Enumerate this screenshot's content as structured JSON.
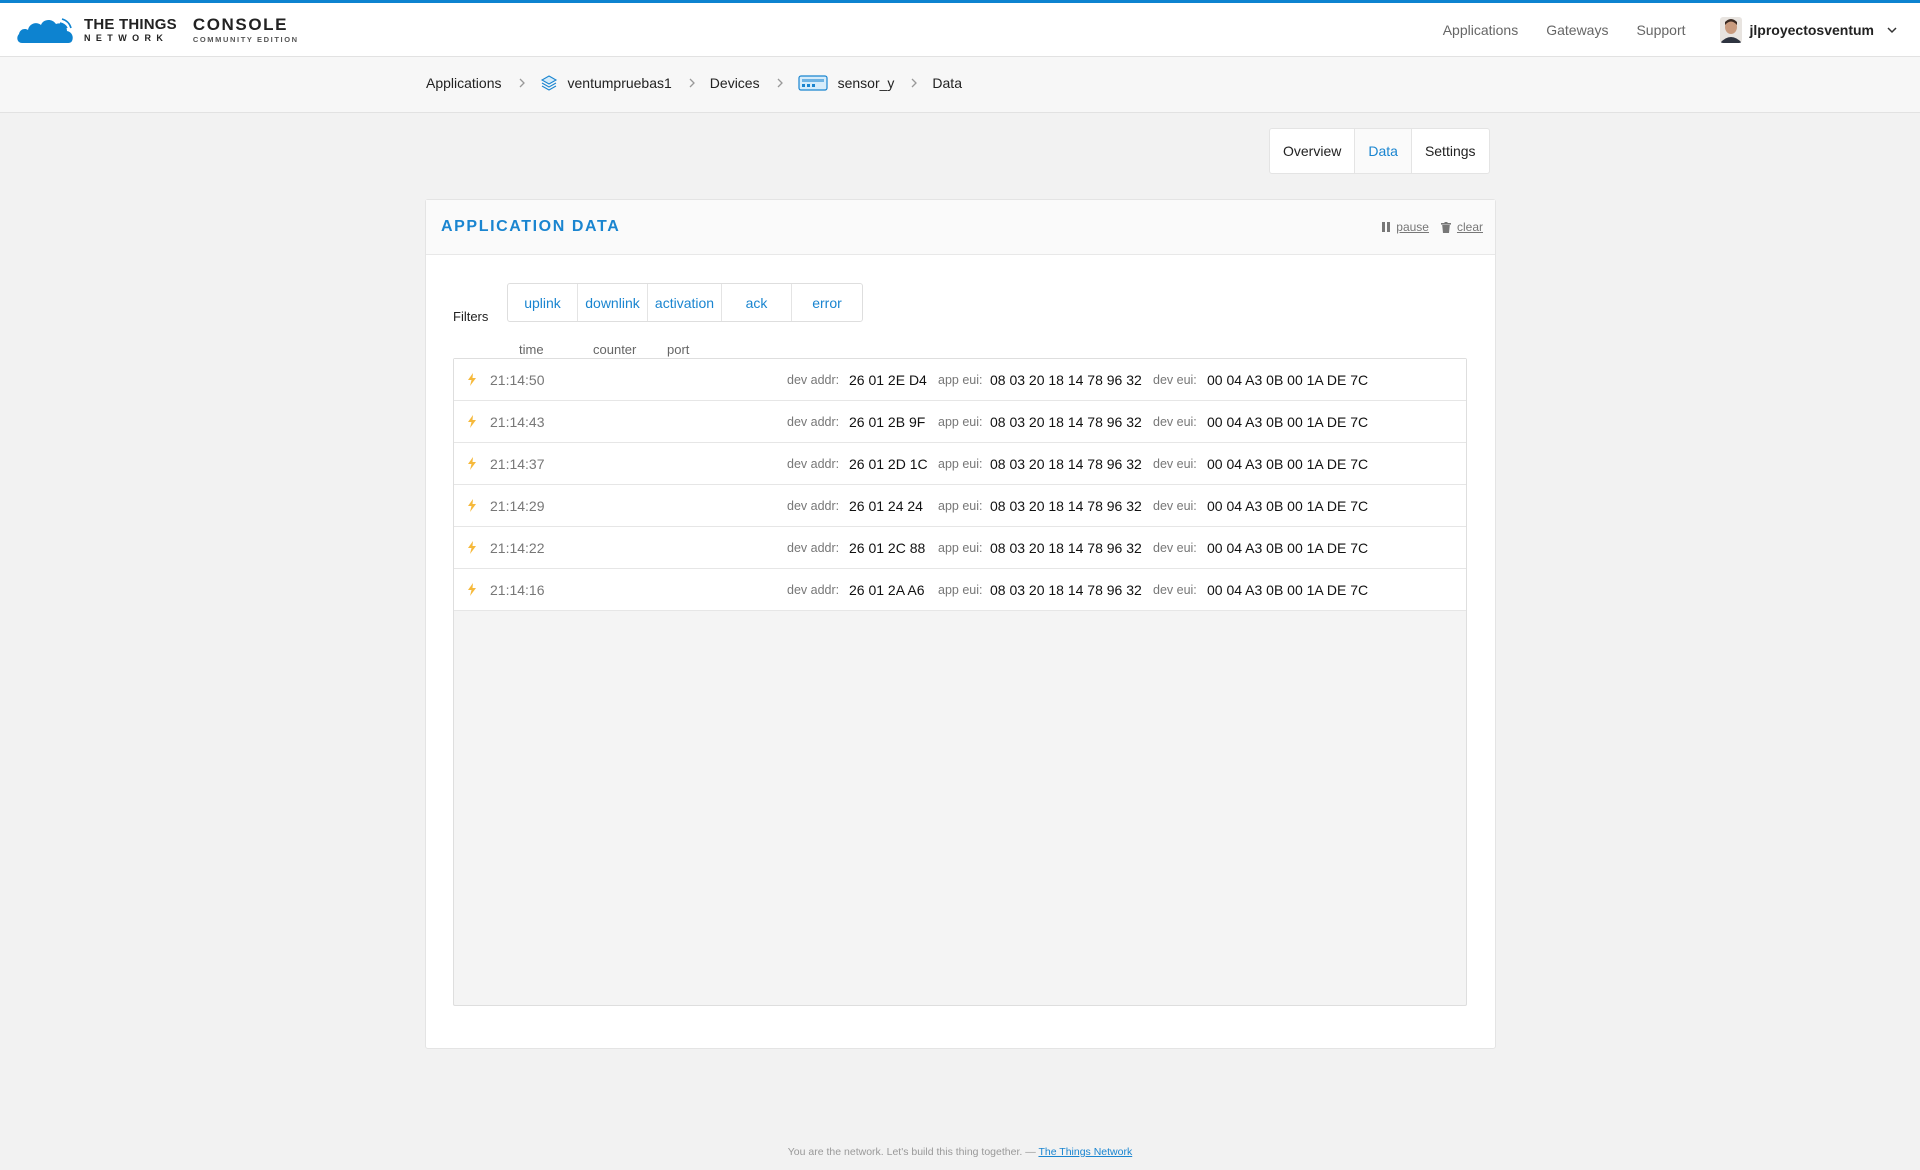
{
  "brand": {
    "line1": "THE THINGS",
    "line2": "NETWORK",
    "console": "CONSOLE",
    "edition": "COMMUNITY EDITION",
    "color": "#0d83d0"
  },
  "nav": {
    "applications": "Applications",
    "gateways": "Gateways",
    "support": "Support",
    "username": "jlproyectosventum"
  },
  "breadcrumb": {
    "applications": "Applications",
    "app": "ventumpruebas1",
    "devices": "Devices",
    "device": "sensor_y",
    "current": "Data"
  },
  "tabs": {
    "overview": "Overview",
    "data": "Data",
    "settings": "Settings",
    "active": "data"
  },
  "panel": {
    "title": "APPLICATION DATA",
    "pause": "pause",
    "clear": "clear"
  },
  "filters": {
    "label": "Filters",
    "items": [
      "uplink",
      "downlink",
      "activation",
      "ack",
      "error"
    ]
  },
  "columns": {
    "time": "time",
    "counter": "counter",
    "port": "port"
  },
  "rows": [
    {
      "icon": "activation-bolt-icon",
      "time": "21:14:50",
      "dev_addr_label": "dev addr:",
      "dev_addr": "26 01 2E D4",
      "app_eui_label": "app eui:",
      "app_eui": "08 03 20 18 14 78 96 32",
      "dev_eui_label": "dev eui:",
      "dev_eui": "00 04 A3 0B 00 1A DE 7C"
    },
    {
      "icon": "activation-bolt-icon",
      "time": "21:14:43",
      "dev_addr_label": "dev addr:",
      "dev_addr": "26 01 2B 9F",
      "app_eui_label": "app eui:",
      "app_eui": "08 03 20 18 14 78 96 32",
      "dev_eui_label": "dev eui:",
      "dev_eui": "00 04 A3 0B 00 1A DE 7C"
    },
    {
      "icon": "activation-bolt-icon",
      "time": "21:14:37",
      "dev_addr_label": "dev addr:",
      "dev_addr": "26 01 2D 1C",
      "app_eui_label": "app eui:",
      "app_eui": "08 03 20 18 14 78 96 32",
      "dev_eui_label": "dev eui:",
      "dev_eui": "00 04 A3 0B 00 1A DE 7C"
    },
    {
      "icon": "activation-bolt-icon",
      "time": "21:14:29",
      "dev_addr_label": "dev addr:",
      "dev_addr": "26 01 24 24",
      "app_eui_label": "app eui:",
      "app_eui": "08 03 20 18 14 78 96 32",
      "dev_eui_label": "dev eui:",
      "dev_eui": "00 04 A3 0B 00 1A DE 7C"
    },
    {
      "icon": "activation-bolt-icon",
      "time": "21:14:22",
      "dev_addr_label": "dev addr:",
      "dev_addr": "26 01 2C 88",
      "app_eui_label": "app eui:",
      "app_eui": "08 03 20 18 14 78 96 32",
      "dev_eui_label": "dev eui:",
      "dev_eui": "00 04 A3 0B 00 1A DE 7C"
    },
    {
      "icon": "activation-bolt-icon",
      "time": "21:14:16",
      "dev_addr_label": "dev addr:",
      "dev_addr": "26 01 2A A6",
      "app_eui_label": "app eui:",
      "app_eui": "08 03 20 18 14 78 96 32",
      "dev_eui_label": "dev eui:",
      "dev_eui": "00 04 A3 0B 00 1A DE 7C"
    }
  ],
  "footer": {
    "text": "You are the network. Let's build this thing together. —",
    "link": "The Things Network"
  }
}
